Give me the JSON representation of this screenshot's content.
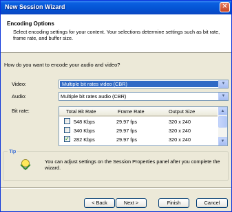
{
  "window": {
    "title": "New Session Wizard",
    "close_glyph": "✕"
  },
  "header": {
    "title": "Encoding Options",
    "description": "Select encoding settings for your content. Your selections determine settings such as bit rate, frame rate, and buffer size."
  },
  "question": "How do you want to encode your audio and video?",
  "video": {
    "label": "Video:",
    "value": "Multiple bit rates video (CBR)"
  },
  "audio": {
    "label": "Audio:",
    "value": "Multiple bit rates audio (CBR)"
  },
  "bitrate": {
    "label": "Bit rate:",
    "columns": [
      "Total Bit Rate",
      "Frame Rate",
      "Output Size"
    ],
    "rows": [
      {
        "checked": false,
        "bit_rate": "548 Kbps",
        "frame_rate": "29.97 fps",
        "size": "320 x 240"
      },
      {
        "checked": false,
        "bit_rate": "340 Kbps",
        "frame_rate": "29.97 fps",
        "size": "320 x 240"
      },
      {
        "checked": true,
        "bit_rate": "282 Kbps",
        "frame_rate": "29.97 fps",
        "size": "320 x 240"
      }
    ]
  },
  "tip": {
    "legend": "Tip",
    "text": "You can adjust settings on the Session Properties panel after you complete the wizard.",
    "icon": "lightbulb-icon"
  },
  "buttons": {
    "back": "< Back",
    "next": "Next >",
    "finish": "Finish",
    "cancel": "Cancel"
  },
  "colors": {
    "title_bar": "#0a5fe0",
    "selection": "#316ac5",
    "tip_legend": "#0046d5"
  }
}
